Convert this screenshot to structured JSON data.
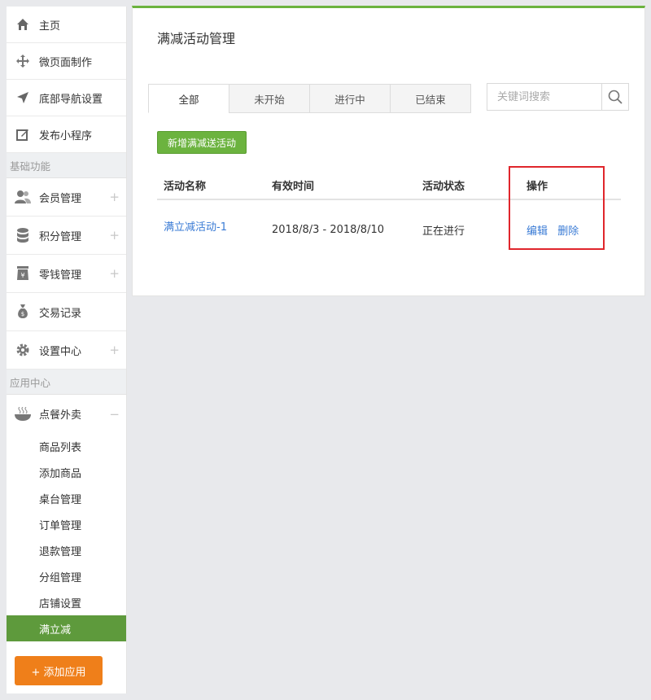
{
  "sidebar": {
    "items": [
      {
        "label": "主页",
        "icon": "home-icon"
      },
      {
        "label": "微页面制作",
        "icon": "move-icon"
      },
      {
        "label": "底部导航设置",
        "icon": "navigation-arrow-icon"
      },
      {
        "label": "发布小程序",
        "icon": "edit-icon"
      }
    ],
    "section_basic": "基础功能",
    "basic_items": [
      {
        "label": "会员管理",
        "icon": "users-icon",
        "expand": "+"
      },
      {
        "label": "积分管理",
        "icon": "database-icon",
        "expand": "+"
      },
      {
        "label": "零钱管理",
        "icon": "money-jar-icon",
        "expand": "+"
      },
      {
        "label": "交易记录",
        "icon": "money-bag-icon"
      },
      {
        "label": "设置中心",
        "icon": "gear-icon",
        "expand": "+"
      }
    ],
    "section_apps": "应用中心",
    "app_group": {
      "label": "点餐外卖",
      "icon": "food-bowl-icon",
      "expand": "−"
    },
    "sub_items": [
      "商品列表",
      "添加商品",
      "桌台管理",
      "订单管理",
      "退款管理",
      "分组管理",
      "店铺设置",
      "满立减"
    ],
    "add_app_label": "+ 添加应用"
  },
  "main": {
    "title": "满减活动管理",
    "tabs": [
      "全部",
      "未开始",
      "进行中",
      "已结束"
    ],
    "search_placeholder": "关键词搜索",
    "add_button": "新增满减送活动",
    "table": {
      "headers": [
        "活动名称",
        "有效时间",
        "活动状态",
        "操作"
      ],
      "rows": [
        {
          "name": "满立减活动-1",
          "period": "2018/8/3 - 2018/8/10",
          "status": "正在进行",
          "edit": "编辑",
          "delete": "删除"
        }
      ]
    }
  },
  "colors": {
    "accent_green": "#6cb33f",
    "active_sub": "#5e9a3c",
    "add_app_orange": "#ef7f1a",
    "link_blue": "#3a7bd5",
    "highlight_red": "#e0262c"
  }
}
